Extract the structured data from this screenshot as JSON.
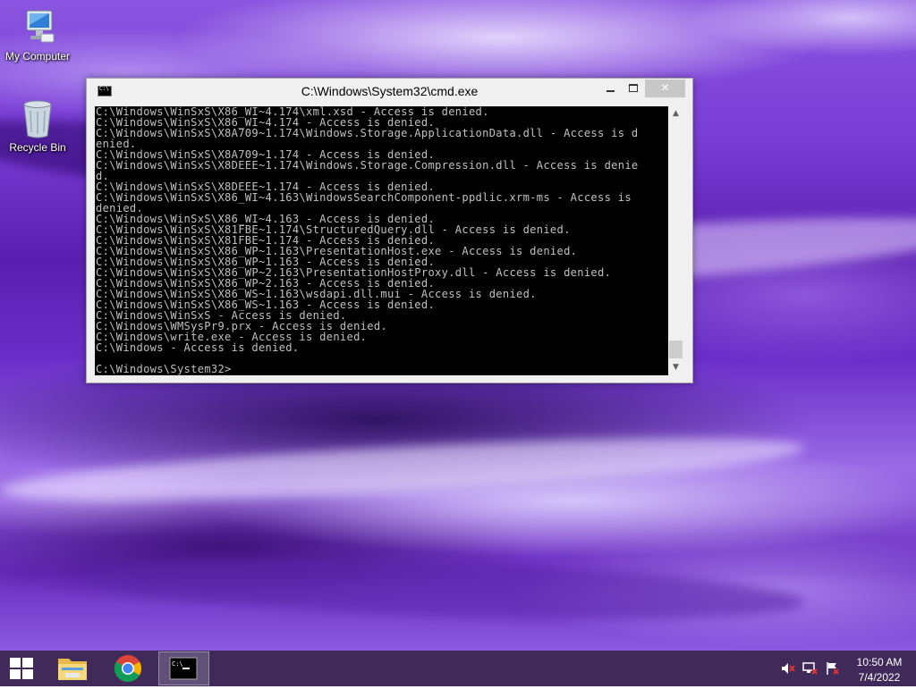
{
  "desktop": {
    "icons": [
      {
        "label": "My Computer",
        "icon": "computer-icon"
      },
      {
        "label": "Recycle Bin",
        "icon": "recycle-bin-icon"
      }
    ]
  },
  "window": {
    "title": "C:\\Windows\\System32\\cmd.exe",
    "icon": "cmd-icon",
    "controls": {
      "minimize": "minimize-icon",
      "maximize": "maximize-icon",
      "close": "close-icon"
    },
    "console_lines": [
      "C:\\Windows\\WinSxS\\X86_WI~4.174\\xml.xsd - Access is denied.",
      "C:\\Windows\\WinSxS\\X86_WI~4.174 - Access is denied.",
      "C:\\Windows\\WinSxS\\X8A709~1.174\\Windows.Storage.ApplicationData.dll - Access is d",
      "enied.",
      "C:\\Windows\\WinSxS\\X8A709~1.174 - Access is denied.",
      "C:\\Windows\\WinSxS\\X8DEEE~1.174\\Windows.Storage.Compression.dll - Access is denie",
      "d.",
      "C:\\Windows\\WinSxS\\X8DEEE~1.174 - Access is denied.",
      "C:\\Windows\\WinSxS\\X86_WI~4.163\\WindowsSearchComponent-ppdlic.xrm-ms - Access is",
      "denied.",
      "C:\\Windows\\WinSxS\\X86_WI~4.163 - Access is denied.",
      "C:\\Windows\\WinSxS\\X81FBE~1.174\\StructuredQuery.dll - Access is denied.",
      "C:\\Windows\\WinSxS\\X81FBE~1.174 - Access is denied.",
      "C:\\Windows\\WinSxS\\X86_WP~1.163\\PresentationHost.exe - Access is denied.",
      "C:\\Windows\\WinSxS\\X86_WP~1.163 - Access is denied.",
      "C:\\Windows\\WinSxS\\X86_WP~2.163\\PresentationHostProxy.dll - Access is denied.",
      "C:\\Windows\\WinSxS\\X86_WP~2.163 - Access is denied.",
      "C:\\Windows\\WinSxS\\X86_WS~1.163\\wsdapi.dll.mui - Access is denied.",
      "C:\\Windows\\WinSxS\\X86_WS~1.163 - Access is denied.",
      "C:\\Windows\\WinSxS - Access is denied.",
      "C:\\Windows\\WMSysPr9.prx - Access is denied.",
      "C:\\Windows\\write.exe - Access is denied.",
      "C:\\Windows - Access is denied.",
      "",
      "C:\\Windows\\System32>"
    ],
    "scrollbar": {
      "position_fraction": 0.95
    }
  },
  "taskbar": {
    "start_icon": "windows-logo-icon",
    "apps": [
      {
        "name": "File Explorer",
        "icon": "folder-icon",
        "active": false
      },
      {
        "name": "Google Chrome",
        "icon": "chrome-icon",
        "active": false
      },
      {
        "name": "Command Prompt",
        "icon": "cmd-icon",
        "active": true
      }
    ],
    "tray": {
      "icons": [
        "speaker-muted-icon",
        "network-icon",
        "flag-icon"
      ],
      "time": "10:50 AM",
      "date": "7/4/2022"
    }
  }
}
